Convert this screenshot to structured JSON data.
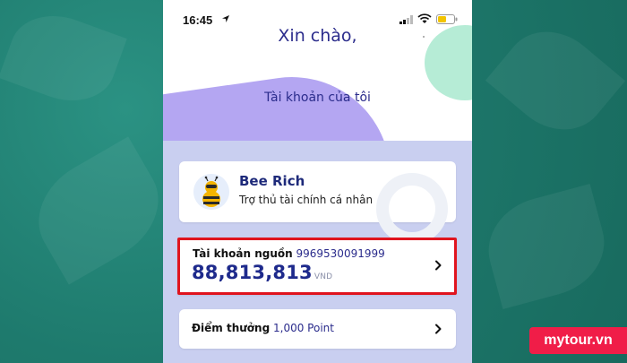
{
  "status_bar": {
    "time": "16:45"
  },
  "header": {
    "greeting": "Xin chào,",
    "account_heading": "Tài khoản của tôi"
  },
  "assistant_card": {
    "name": "Bee Rich",
    "subtitle": "Trợ thủ tài chính cá nhân"
  },
  "source_account": {
    "label": "Tài khoản nguồn",
    "account_number": "9969530091999",
    "balance": "88,813,813",
    "currency": "VND"
  },
  "points": {
    "label": "Điểm thưởng",
    "value": "1,000 Point"
  },
  "watermark": {
    "text": "mytour.vn"
  },
  "colors": {
    "accent_navy": "#1e2a8c",
    "highlight_red": "#e0141e",
    "purple": "#b4a6f2",
    "mint": "#b6ecd6",
    "background_lavender": "#c9cff0",
    "backdrop_teal": "#1f7f72"
  },
  "icons": [
    "location-arrow-icon",
    "signal-icon",
    "wifi-icon",
    "battery-icon",
    "chevron-right-icon",
    "bee-avatar-icon"
  ]
}
